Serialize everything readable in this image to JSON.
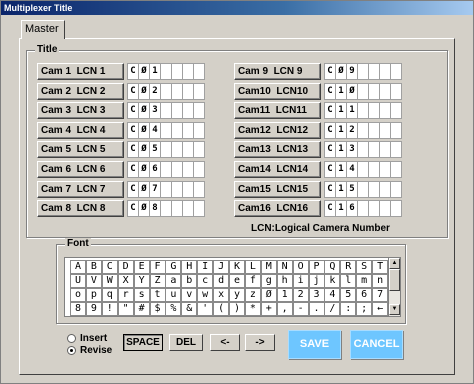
{
  "window": {
    "title": "Multiplexer Title"
  },
  "tabs": [
    {
      "label": "Master"
    }
  ],
  "title_group": {
    "legend": "Title",
    "cameras_left": [
      {
        "label": "Cam 1  LCN 1",
        "value": [
          "C",
          "Ø",
          "1",
          "",
          "",
          "",
          ""
        ]
      },
      {
        "label": "Cam 2  LCN 2",
        "value": [
          "C",
          "Ø",
          "2",
          "",
          "",
          "",
          ""
        ]
      },
      {
        "label": "Cam 3  LCN 3",
        "value": [
          "C",
          "Ø",
          "3",
          "",
          "",
          "",
          ""
        ]
      },
      {
        "label": "Cam 4  LCN 4",
        "value": [
          "C",
          "Ø",
          "4",
          "",
          "",
          "",
          ""
        ]
      },
      {
        "label": "Cam 5  LCN 5",
        "value": [
          "C",
          "Ø",
          "5",
          "",
          "",
          "",
          ""
        ]
      },
      {
        "label": "Cam 6  LCN 6",
        "value": [
          "C",
          "Ø",
          "6",
          "",
          "",
          "",
          ""
        ]
      },
      {
        "label": "Cam 7  LCN 7",
        "value": [
          "C",
          "Ø",
          "7",
          "",
          "",
          "",
          ""
        ]
      },
      {
        "label": "Cam 8  LCN 8",
        "value": [
          "C",
          "Ø",
          "8",
          "",
          "",
          "",
          ""
        ]
      }
    ],
    "cameras_right": [
      {
        "label": "Cam 9  LCN 9",
        "value": [
          "C",
          "Ø",
          "9",
          "",
          "",
          "",
          ""
        ]
      },
      {
        "label": "Cam10  LCN10",
        "value": [
          "C",
          "1",
          "Ø",
          "",
          "",
          "",
          ""
        ]
      },
      {
        "label": "Cam11  LCN11",
        "value": [
          "C",
          "1",
          "1",
          "",
          "",
          "",
          ""
        ]
      },
      {
        "label": "Cam12  LCN12",
        "value": [
          "C",
          "1",
          "2",
          "",
          "",
          "",
          ""
        ]
      },
      {
        "label": "Cam13  LCN13",
        "value": [
          "C",
          "1",
          "3",
          "",
          "",
          "",
          ""
        ]
      },
      {
        "label": "Cam14  LCN14",
        "value": [
          "C",
          "1",
          "4",
          "",
          "",
          "",
          ""
        ]
      },
      {
        "label": "Cam15  LCN15",
        "value": [
          "C",
          "1",
          "5",
          "",
          "",
          "",
          ""
        ]
      },
      {
        "label": "Cam16  LCN16",
        "value": [
          "C",
          "1",
          "6",
          "",
          "",
          "",
          ""
        ]
      }
    ],
    "note": "LCN:Logical Camera Number"
  },
  "font_group": {
    "legend": "Font",
    "rows": [
      [
        "A",
        "B",
        "C",
        "D",
        "E",
        "F",
        "G",
        "H",
        "I",
        "J",
        "K",
        "L",
        "M",
        "N",
        "O",
        "P",
        "Q",
        "R",
        "S",
        "T"
      ],
      [
        "U",
        "V",
        "W",
        "X",
        "Y",
        "Z",
        "a",
        "b",
        "c",
        "d",
        "e",
        "f",
        "g",
        "h",
        "i",
        "j",
        "k",
        "l",
        "m",
        "n"
      ],
      [
        "o",
        "p",
        "q",
        "r",
        "s",
        "t",
        "u",
        "v",
        "w",
        "x",
        "y",
        "z",
        "Ø",
        "1",
        "2",
        "3",
        "4",
        "5",
        "6",
        "7"
      ],
      [
        "8",
        "9",
        "!",
        "\"",
        "#",
        "$",
        "%",
        "&",
        "'",
        "(",
        ")",
        "*",
        "+",
        ",",
        "-",
        ".",
        "/",
        ":",
        ";",
        "←"
      ]
    ],
    "scroll_up_icon": "▲",
    "scroll_down_icon": "▼"
  },
  "mode": {
    "insert_label": "Insert",
    "revise_label": "Revise",
    "selected": "revise"
  },
  "edit_buttons": {
    "space": "SPACE",
    "del": "DEL",
    "left": "<-",
    "right": "->"
  },
  "actions": {
    "save": "SAVE",
    "cancel": "CANCEL"
  }
}
